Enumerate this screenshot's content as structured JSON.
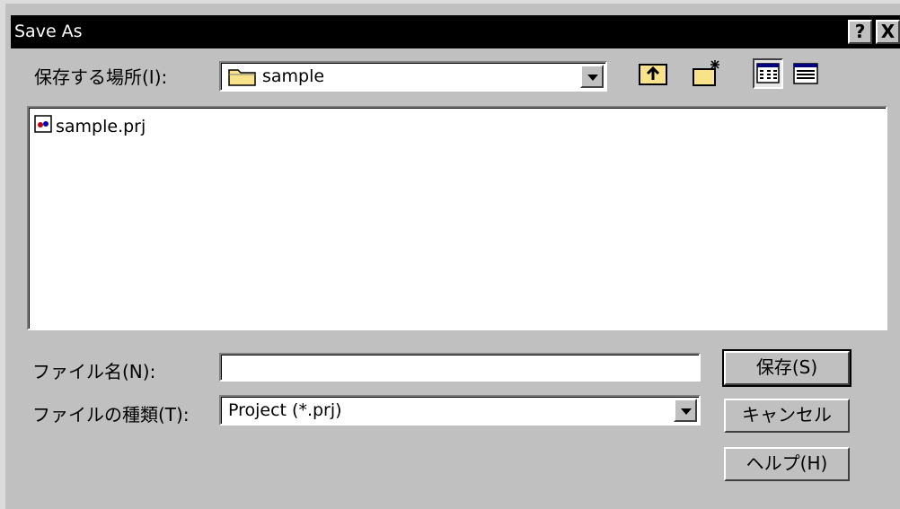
{
  "window": {
    "title": "Save As",
    "help_label": "?",
    "close_label": "X"
  },
  "location": {
    "label": "保存する場所(I):",
    "value": "sample"
  },
  "toolbar": {
    "up_icon": "up-folder-icon",
    "newfolder_icon": "new-folder-icon",
    "list_icon": "list-view-icon",
    "details_icon": "details-view-icon"
  },
  "files": [
    {
      "name": "sample.prj",
      "icon": "project-file-icon"
    }
  ],
  "filename": {
    "label": "ファイル名(N):",
    "value": ""
  },
  "filetype": {
    "label": "ファイルの種類(T):",
    "value": "Project (*.prj)"
  },
  "buttons": {
    "save": "保存(S)",
    "cancel": "キャンセル",
    "help": "ヘルプ(H)"
  }
}
